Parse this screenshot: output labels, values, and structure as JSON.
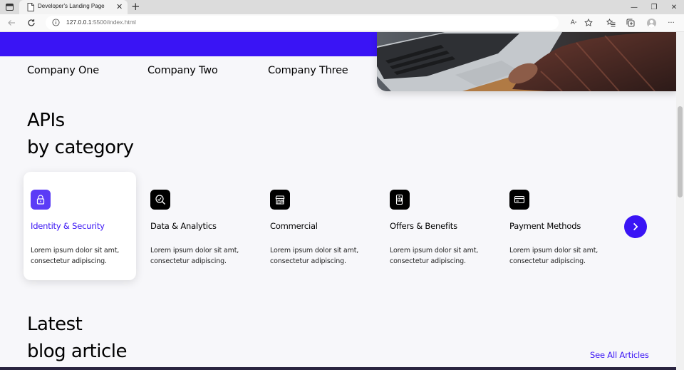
{
  "browser": {
    "tab_title": "Developer's Landing Page",
    "tab_close": "✕",
    "new_tab": "+",
    "url_host": "127.0.0.1",
    "url_rest": ":5500/index.html",
    "window_controls": [
      "—",
      "❐",
      "✕"
    ],
    "read_aloud": "A",
    "more": "···"
  },
  "companies": [
    "Company One",
    "Company Two",
    "Company Three"
  ],
  "apis": {
    "title_line1": "APIs",
    "title_line2": "by category",
    "categories": [
      {
        "name": "Identity & Security",
        "description": "Lorem ipsum dolor sit amt, consectetur adipiscing.",
        "icon": "lock-icon",
        "active": true
      },
      {
        "name": "Data & Analytics",
        "description": "Lorem ipsum dolor sit amt, consectetur adipiscing.",
        "icon": "chart-search-icon",
        "active": false
      },
      {
        "name": "Commercial",
        "description": "Lorem ipsum dolor sit amt, consectetur adipiscing.",
        "icon": "store-icon",
        "active": false
      },
      {
        "name": "Offers & Benefits",
        "description": "Lorem ipsum dolor sit amt, consectetur adipiscing.",
        "icon": "gift-phone-icon",
        "active": false
      },
      {
        "name": "Payment Methods",
        "description": "Lorem ipsum dolor sit amt, consectetur adipiscing.",
        "icon": "credit-card-icon",
        "active": false
      }
    ]
  },
  "blog": {
    "title_line1": "Latest",
    "title_line2": "blog article",
    "see_all": "See All Articles"
  },
  "colors": {
    "accent": "#3a14f5",
    "active_icon": "#5b3cf6",
    "page_bg": "#f7f7fa"
  }
}
